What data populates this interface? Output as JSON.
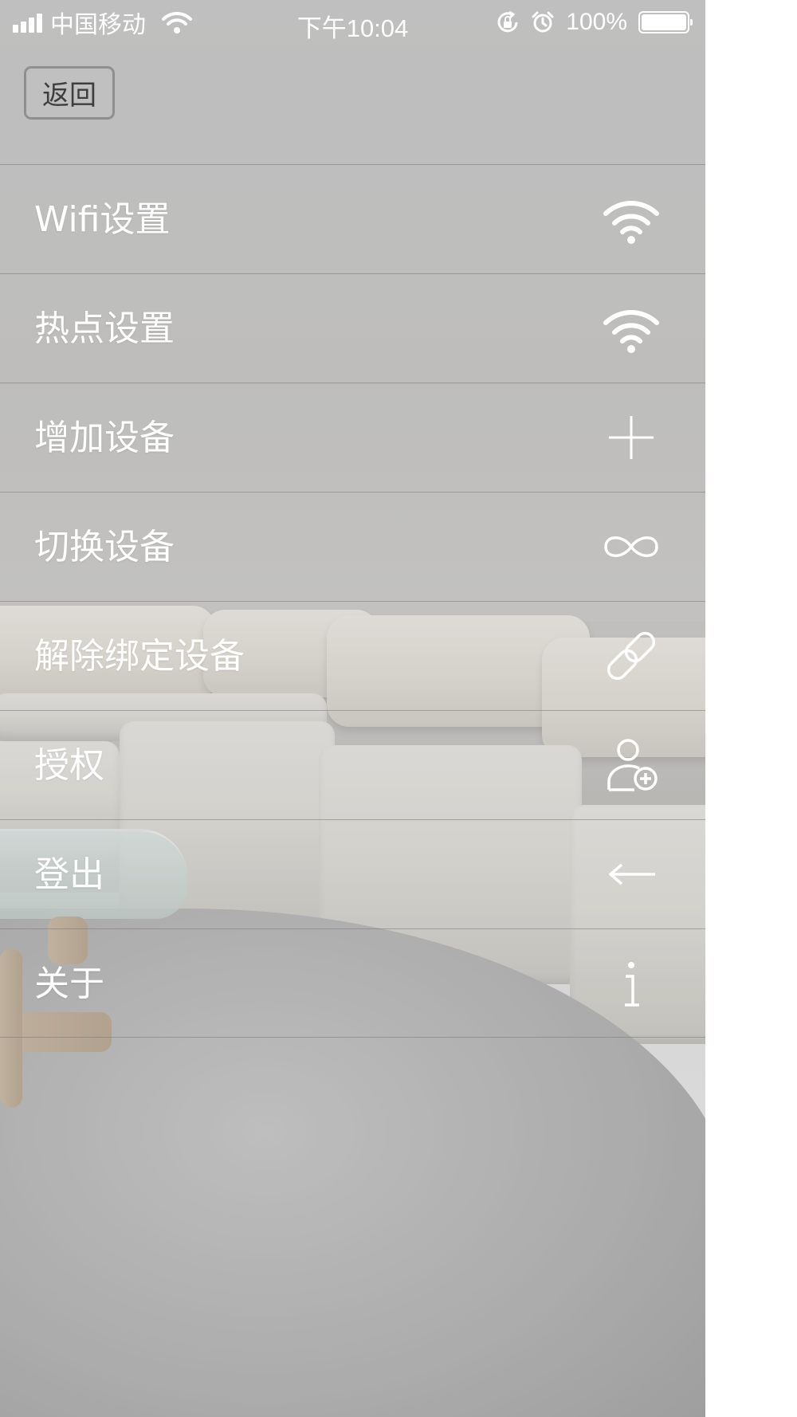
{
  "status_bar": {
    "carrier": "中国移动",
    "time": "下午10:04",
    "battery": "100%",
    "signal_icon": "signal-bars-icon",
    "wifi_icon": "wifi-icon",
    "rotation_lock_icon": "rotation-lock-icon",
    "alarm_icon": "alarm-icon",
    "battery_icon": "battery-icon"
  },
  "header": {
    "back_label": "返回"
  },
  "menu": {
    "items": [
      {
        "label": "Wifi设置",
        "icon": "wifi-icon"
      },
      {
        "label": "热点设置",
        "icon": "wifi-icon"
      },
      {
        "label": "增加设备",
        "icon": "plus-icon"
      },
      {
        "label": "切换设备",
        "icon": "infinity-icon"
      },
      {
        "label": "解除绑定设备",
        "icon": "link-icon"
      },
      {
        "label": "授权",
        "icon": "add-user-icon"
      },
      {
        "label": "登出",
        "icon": "arrow-left-icon"
      },
      {
        "label": "关于",
        "icon": "info-icon"
      }
    ]
  },
  "colors": {
    "menu_text": "#ffffff",
    "divider": "#8a8a8a",
    "back_button_border": "#8f8f8f",
    "back_button_text": "#3e3e3e"
  }
}
